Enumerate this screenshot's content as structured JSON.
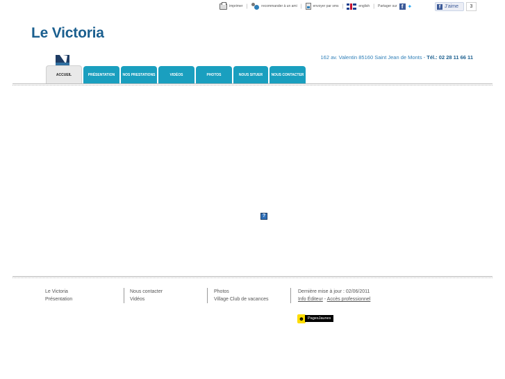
{
  "topbar": {
    "print": "imprimer",
    "recommend": "recommander à un ami",
    "email": "envoyer par sms",
    "english": "english",
    "share": "Partager sur",
    "like": "J'aime",
    "like_count": "3"
  },
  "header": {
    "title": "Le Victoria",
    "address": "162 av. Valentin 85160 Saint Jean de Monts",
    "tel_label": "Tél.: 02 28 11 66 11"
  },
  "nav": {
    "items": [
      {
        "label": "ACCUEIL"
      },
      {
        "label": "PRÉSENTATION"
      },
      {
        "label": "NOS PRESTATIONS"
      },
      {
        "label": "VIDÉOS"
      },
      {
        "label": "PHOTOS"
      },
      {
        "label": "NOUS SITUER"
      },
      {
        "label": "NOUS CONTACTER"
      }
    ]
  },
  "footer": {
    "col1": [
      "Le Victoria",
      "Présentation"
    ],
    "col2": [
      "Nous contacter",
      "Vidéos"
    ],
    "col3": [
      "Photos",
      "Village Club de vacances"
    ],
    "updated": "Dernière mise à jour : 02/06/2011",
    "info_editeur": "Info Éditeur",
    "dash": "-",
    "acces_pro": "Accès professionnel",
    "pj_label": "PagesJaunes"
  }
}
